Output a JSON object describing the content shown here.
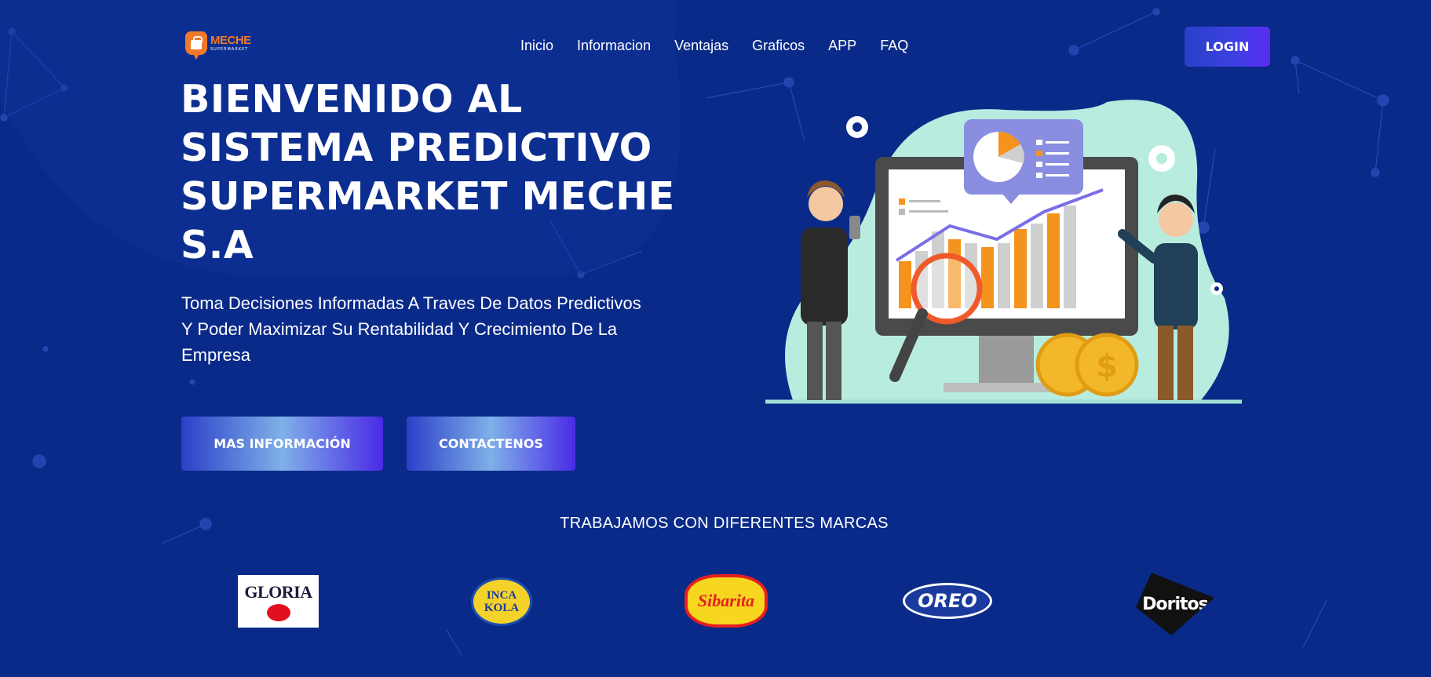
{
  "nav": {
    "logo_name": "MECHE",
    "logo_sub": "SUPERMARKET",
    "links": [
      "Inicio",
      "Informacion",
      "Ventajas",
      "Graficos",
      "APP",
      "FAQ"
    ],
    "login_label": "LOGIN"
  },
  "hero": {
    "title_lines": [
      "BIENVENIDO AL",
      "SISTEMA PREDICTIVO",
      "SUPERMARKET MECHE",
      "S.A"
    ],
    "subtitle_lines": [
      "Toma Decisiones Informadas A Traves De Datos Predictivos",
      "Y Poder Maximizar Su Rentabilidad Y Crecimiento De La",
      "Empresa"
    ],
    "btn_info": "MAS INFORMACIÓN",
    "btn_contact": "CONTACTENOS"
  },
  "brands": {
    "title": "TRABAJAMOS CON DIFERENTES MARCAS",
    "items": [
      "GLORIA",
      "INCA KOLA",
      "Sibarita",
      "OREO",
      "Doritos"
    ]
  },
  "colors": {
    "background": "#0a2a8a",
    "accent_orange": "#f07a2a",
    "button_blue": "#3f3fe3"
  }
}
